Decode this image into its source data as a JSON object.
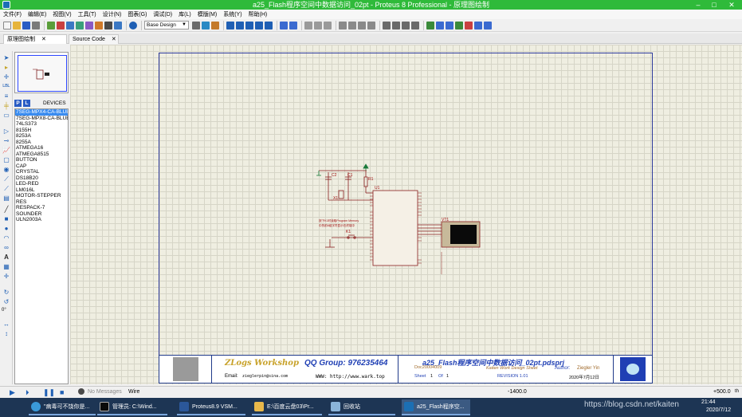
{
  "window": {
    "title": "a25_Flash程序空间中数据访问_02pt - Proteus 8 Professional - 原理图绘制"
  },
  "menu": [
    "文件(F)",
    "编辑(E)",
    "视图(V)",
    "工具(T)",
    "设计(N)",
    "图表(G)",
    "调试(D)",
    "库(L)",
    "模版(M)",
    "系统(Y)",
    "帮助(H)"
  ],
  "toolbar": {
    "design_select": "Base Design"
  },
  "tabs": [
    {
      "label": "原理图绘制",
      "active": true
    },
    {
      "label": "Source Code",
      "active": false
    }
  ],
  "device_panel": {
    "p_button": "P",
    "l_button": "L",
    "header": "DEVICES",
    "items": [
      "7SEG-MPX4-CA-BLUE",
      "7SEG-MPX8-CA-BLUE",
      "74LS373",
      "8155H",
      "8253A",
      "8255A",
      "ATMEGA16",
      "ATMEGA8515",
      "BUTTON",
      "CAP",
      "CRYSTAL",
      "DS18B20",
      "LED-RED",
      "LM016L",
      "MOTOR-STEPPER",
      "RES",
      "RESPACK-7",
      "SOUNDER",
      "ULN2003A"
    ],
    "selected_index": 0
  },
  "rotation": "0°",
  "schematic": {
    "labels": {
      "c2": "C2",
      "c1": "C1",
      "r1": "R1",
      "x1": "X1",
      "u1": "U1",
      "vt1": "VT1",
      "k1": "K1",
      "note_line1": "按下K1时读取Program Memory",
      "note_line2": "中的前6组字符显示在终端中"
    }
  },
  "title_block": {
    "brand": "ZLogs Workshop",
    "qq": "QQ Group: 976235464",
    "email_label": "Email:",
    "email": "zieglerpin@sina.com",
    "www": "WWW: http://www.wark.top",
    "project": "a25_Flash程序空间中数据访问_02pt.pdsprj",
    "doc": "Doc20004009",
    "design_sheet": "Kaiten Work Design Sheet",
    "author_label": "Author:",
    "author": "Ziegler Yin",
    "sheet_label": "Sheet",
    "sheet_num": "1",
    "of_label": "Of",
    "of_num": "1",
    "revision": "REVISION 1.01",
    "date": "2020年7月12日"
  },
  "status": {
    "messages": "No Messages",
    "mode": "Wire",
    "coord_x": "-1400.0",
    "coord_y": "+500.0",
    "unit": "th"
  },
  "taskbar": {
    "items": [
      "\"病毒可不饶你是...",
      "管理员: C:\\Wind...",
      "Proteus8.9 VSM...",
      "E:\\百度云盘03\\Pr...",
      "回收站",
      "a25_Flash程序空..."
    ],
    "watermark": "https://blog.csdn.net/kaiten",
    "time": "21:44",
    "date": "2020/7/12"
  }
}
